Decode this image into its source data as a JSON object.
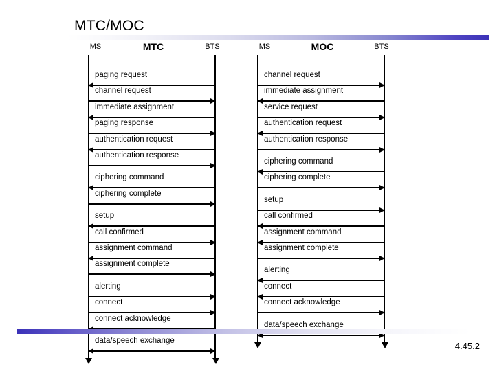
{
  "slide": {
    "title": "MTC/MOC",
    "footer_number": "4.45.2",
    "accent_color": "#3b32b8"
  },
  "diagrams": [
    {
      "id": "mtc",
      "name": "MTC",
      "left_actor": "MS",
      "right_actor": "BTS",
      "messages": [
        {
          "label": "paging request",
          "direction": "left",
          "group_gap": false
        },
        {
          "label": "channel request",
          "direction": "right",
          "group_gap": false
        },
        {
          "label": "immediate assignment",
          "direction": "left",
          "group_gap": false
        },
        {
          "label": "paging response",
          "direction": "right",
          "group_gap": false
        },
        {
          "label": "authentication request",
          "direction": "left",
          "group_gap": false
        },
        {
          "label": "authentication response",
          "direction": "right",
          "group_gap": false
        },
        {
          "label": "ciphering command",
          "direction": "left",
          "group_gap": true
        },
        {
          "label": "ciphering complete",
          "direction": "right",
          "group_gap": false
        },
        {
          "label": "setup",
          "direction": "left",
          "group_gap": true
        },
        {
          "label": "call confirmed",
          "direction": "right",
          "group_gap": false
        },
        {
          "label": "assignment command",
          "direction": "left",
          "group_gap": false
        },
        {
          "label": "assignment complete",
          "direction": "right",
          "group_gap": false
        },
        {
          "label": "alerting",
          "direction": "right",
          "group_gap": true
        },
        {
          "label": "connect",
          "direction": "right",
          "group_gap": false
        },
        {
          "label": "connect acknowledge",
          "direction": "left",
          "group_gap": false
        },
        {
          "label": "data/speech exchange",
          "direction": "both",
          "group_gap": true
        }
      ]
    },
    {
      "id": "moc",
      "name": "MOC",
      "left_actor": "MS",
      "right_actor": "BTS",
      "messages": [
        {
          "label": "channel request",
          "direction": "right",
          "group_gap": false
        },
        {
          "label": "immediate assignment",
          "direction": "left",
          "group_gap": false
        },
        {
          "label": "service request",
          "direction": "right",
          "group_gap": false
        },
        {
          "label": "authentication request",
          "direction": "left",
          "group_gap": false
        },
        {
          "label": "authentication response",
          "direction": "right",
          "group_gap": false
        },
        {
          "label": "ciphering command",
          "direction": "left",
          "group_gap": true
        },
        {
          "label": "ciphering complete",
          "direction": "right",
          "group_gap": false
        },
        {
          "label": "setup",
          "direction": "right",
          "group_gap": true
        },
        {
          "label": "call confirmed",
          "direction": "left",
          "group_gap": false
        },
        {
          "label": "assignment command",
          "direction": "left",
          "group_gap": false
        },
        {
          "label": "assignment complete",
          "direction": "right",
          "group_gap": false
        },
        {
          "label": "alerting",
          "direction": "left",
          "group_gap": true
        },
        {
          "label": "connect",
          "direction": "left",
          "group_gap": false
        },
        {
          "label": "connect acknowledge",
          "direction": "right",
          "group_gap": false
        },
        {
          "label": "data/speech exchange",
          "direction": "both",
          "group_gap": true
        }
      ]
    }
  ]
}
